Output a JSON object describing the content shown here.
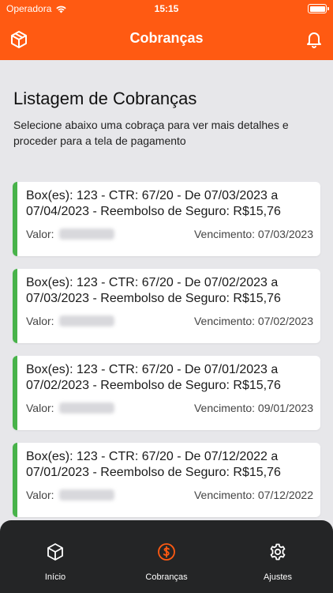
{
  "status_bar": {
    "carrier": "Operadora",
    "time": "15:15"
  },
  "nav": {
    "title": "Cobranças",
    "left_icon": "box-icon",
    "right_icon": "bell-icon"
  },
  "page": {
    "title": "Listagem de Cobranças",
    "subtitle": "Selecione abaixo uma cobraça para ver mais detalhes e proceder para a tela de pagamento"
  },
  "colors": {
    "accent": "#ff5a12",
    "status_bar": "#48b34a",
    "tab_bar": "#242526"
  },
  "cards": [
    {
      "desc": "Box(es): 123 - CTR: 67/20 - De 07/03/2023 a 07/04/2023 - Reembolso de Seguro: R$15,76",
      "valor_label": "Valor:",
      "venc": "Vencimento: 07/03/2023"
    },
    {
      "desc": "Box(es): 123 - CTR: 67/20 - De 07/02/2023 a 07/03/2023 - Reembolso de Seguro: R$15,76",
      "valor_label": "Valor:",
      "venc": "Vencimento: 07/02/2023"
    },
    {
      "desc": "Box(es): 123 - CTR: 67/20 - De 07/01/2023 a 07/02/2023 - Reembolso de Seguro: R$15,76",
      "valor_label": "Valor:",
      "venc": "Vencimento: 09/01/2023"
    },
    {
      "desc": "Box(es): 123 - CTR: 67/20 - De 07/12/2022 a 07/01/2023 - Reembolso de Seguro: R$15,76",
      "valor_label": "Valor:",
      "venc": "Vencimento: 07/12/2022"
    }
  ],
  "tabs": [
    {
      "label": "Início",
      "icon": "box-icon"
    },
    {
      "label": "Cobranças",
      "icon": "dollar-circle-icon",
      "active": true
    },
    {
      "label": "Ajustes",
      "icon": "gear-icon"
    }
  ]
}
